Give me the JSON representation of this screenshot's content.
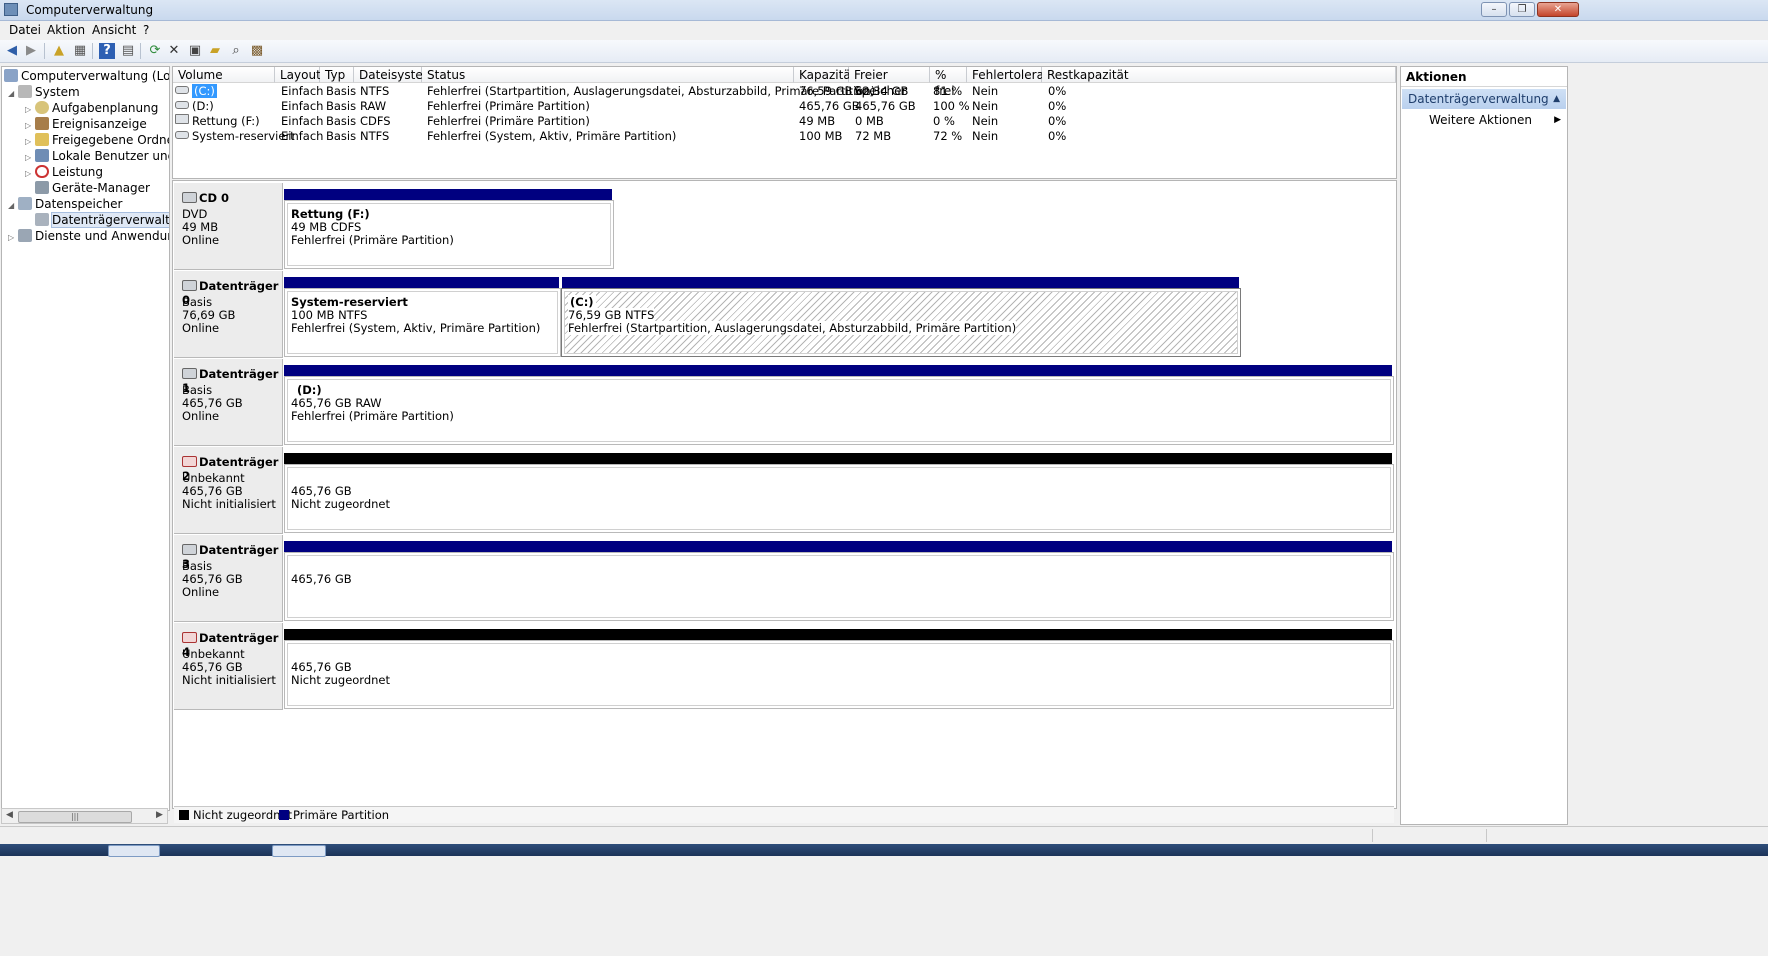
{
  "window": {
    "title": "Computerverwaltung"
  },
  "menu": {
    "items": [
      "Datei",
      "Aktion",
      "Ansicht",
      "?"
    ]
  },
  "tree": {
    "root": "Computerverwaltung (Lokal)",
    "system": "System",
    "aufgabenplanung": "Aufgabenplanung",
    "ereignisanzeige": "Ereignisanzeige",
    "freigegebene_ordner": "Freigegebene Ordner",
    "lokale_benutzer": "Lokale Benutzer und Gr",
    "leistung": "Leistung",
    "geraete_manager": "Geräte-Manager",
    "datenspeicher": "Datenspeicher",
    "datentraegerverwaltung": "Datenträgerverwaltung",
    "dienste": "Dienste und Anwendungen"
  },
  "volume_table": {
    "columns": [
      "Volume",
      "Layout",
      "Typ",
      "Dateisystem",
      "Status",
      "Kapazität",
      "Freier Speicher",
      "% frei",
      "Fehlertoleranz",
      "Restkapazität"
    ],
    "rows": [
      [
        "(C:)",
        "Einfach",
        "Basis",
        "NTFS",
        "Fehlerfrei (Startpartition, Auslagerungsdatei, Absturzabbild, Primäre Partition)",
        "76,59 GB",
        "62,34 GB",
        "81 %",
        "Nein",
        "0%"
      ],
      [
        "(D:)",
        "Einfach",
        "Basis",
        "RAW",
        "Fehlerfrei (Primäre Partition)",
        "465,76 GB",
        "465,76 GB",
        "100 %",
        "Nein",
        "0%"
      ],
      [
        "Rettung (F:)",
        "Einfach",
        "Basis",
        "CDFS",
        "Fehlerfrei (Primäre Partition)",
        "49 MB",
        "0 MB",
        "0 %",
        "Nein",
        "0%"
      ],
      [
        "System-reserviert",
        "Einfach",
        "Basis",
        "NTFS",
        "Fehlerfrei (System, Aktiv, Primäre Partition)",
        "100 MB",
        "72 MB",
        "72 %",
        "Nein",
        "0%"
      ]
    ]
  },
  "disks": {
    "cd0": {
      "name": "CD 0",
      "type": "DVD",
      "size": "49 MB",
      "state": "Online",
      "p1": {
        "title": "Rettung  (F:)",
        "line2": "49 MB CDFS",
        "line3": "Fehlerfrei (Primäre Partition)"
      }
    },
    "d0": {
      "name": "Datenträger 0",
      "type": "Basis",
      "size": "76,69 GB",
      "state": "Online",
      "p1": {
        "title": "System-reserviert",
        "line2": "100 MB NTFS",
        "line3": "Fehlerfrei (System, Aktiv, Primäre Partition)"
      },
      "p2": {
        "title": "(C:)",
        "line2": "76,59 GB NTFS",
        "line3": "Fehlerfrei (Startpartition, Auslagerungsdatei, Absturzabbild, Primäre Partition)"
      }
    },
    "d1": {
      "name": "Datenträger 1",
      "type": "Basis",
      "size": "465,76 GB",
      "state": "Online",
      "p1": {
        "title": "(D:)",
        "line2": "465,76 GB RAW",
        "line3": "Fehlerfrei (Primäre Partition)"
      }
    },
    "d2": {
      "name": "Datenträger 2",
      "type": "Unbekannt",
      "size": "465,76 GB",
      "state": "Nicht initialisiert",
      "p1": {
        "line1": "465,76 GB",
        "line2": "Nicht zugeordnet"
      }
    },
    "d3": {
      "name": "Datenträger 3",
      "type": "Basis",
      "size": "465,76 GB",
      "state": "Online",
      "p1": {
        "line1": "465,76 GB"
      }
    },
    "d4": {
      "name": "Datenträger 4",
      "type": "Unbekannt",
      "size": "465,76 GB",
      "state": "Nicht initialisiert",
      "p1": {
        "line1": "465,76 GB",
        "line2": "Nicht zugeordnet"
      }
    }
  },
  "legend": {
    "unallocated": "Nicht zugeordnet",
    "primary": "Primäre Partition"
  },
  "actions": {
    "header": "Aktionen",
    "section": "Datenträgerverwaltung",
    "more": "Weitere Aktionen"
  },
  "colors": {
    "primary_partition": "#000080",
    "unallocated": "#000000",
    "selection": "#3399ff"
  }
}
